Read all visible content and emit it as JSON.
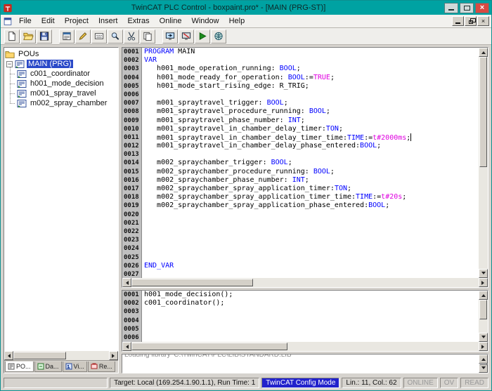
{
  "titlebar": {
    "title": "TwinCAT PLC Control - boxpaint.pro* - [MAIN (PRG-ST)]"
  },
  "menubar": {
    "items": [
      "File",
      "Edit",
      "Project",
      "Insert",
      "Extras",
      "Online",
      "Window",
      "Help"
    ]
  },
  "toolbar": {
    "buttons": [
      {
        "icon": "new-file-icon"
      },
      {
        "icon": "open-file-icon"
      },
      {
        "icon": "save-icon"
      },
      {
        "icon": "new-pou-icon",
        "group": true
      },
      {
        "icon": "edit-declaration-icon"
      },
      {
        "icon": "input-assistant-icon"
      },
      {
        "icon": "find-icon"
      },
      {
        "icon": "cut-icon"
      },
      {
        "icon": "copy-icon"
      },
      {
        "icon": "login-icon",
        "group": true
      },
      {
        "icon": "logout-icon"
      },
      {
        "icon": "run-icon"
      },
      {
        "icon": "global-variables-icon"
      }
    ]
  },
  "sidebar": {
    "root_label": "POUs",
    "selected_item": "MAIN (PRG)",
    "items": [
      "c001_coordinator",
      "h001_mode_decision",
      "m001_spray_travel",
      "m002_spray_chamber"
    ],
    "tabs": [
      {
        "label": "PO...",
        "icon": "pous-tab-icon",
        "active": true
      },
      {
        "label": "Da...",
        "icon": "data-types-tab-icon",
        "active": false
      },
      {
        "label": "Vi...",
        "icon": "visualizations-tab-icon",
        "active": false
      },
      {
        "label": "Re...",
        "icon": "resources-tab-icon",
        "active": false
      }
    ]
  },
  "declaration_editor": {
    "lines": [
      {
        "num": "0001",
        "segs": [
          [
            "PROGRAM",
            "k"
          ],
          [
            " MAIN",
            "p"
          ]
        ]
      },
      {
        "num": "0002",
        "segs": [
          [
            "VAR",
            "k"
          ]
        ]
      },
      {
        "num": "0003",
        "segs": [
          [
            "   h001_mode_operation_running: ",
            "p"
          ],
          [
            "BOOL",
            "k"
          ],
          [
            ";",
            "p"
          ]
        ]
      },
      {
        "num": "0004",
        "segs": [
          [
            "   h001_mode_ready_for_operation: ",
            "p"
          ],
          [
            "BOOL",
            "k"
          ],
          [
            ":=",
            "p"
          ],
          [
            "TRUE",
            "m"
          ],
          [
            ";",
            "p"
          ]
        ]
      },
      {
        "num": "0005",
        "segs": [
          [
            "   h001_mode_start_rising_edge: R_TRIG;",
            "p"
          ]
        ]
      },
      {
        "num": "0006",
        "segs": []
      },
      {
        "num": "0007",
        "segs": [
          [
            "   m001_spraytravel_trigger: ",
            "p"
          ],
          [
            "BOOL",
            "k"
          ],
          [
            ";",
            "p"
          ]
        ]
      },
      {
        "num": "0008",
        "segs": [
          [
            "   m001_spraytravel_procedure_running: ",
            "p"
          ],
          [
            "BOOL",
            "k"
          ],
          [
            ";",
            "p"
          ]
        ]
      },
      {
        "num": "0009",
        "segs": [
          [
            "   m001_spraytravel_phase_number: ",
            "p"
          ],
          [
            "INT",
            "k"
          ],
          [
            ";",
            "p"
          ]
        ]
      },
      {
        "num": "0010",
        "segs": [
          [
            "   m001_spraytravel_in_chamber_delay_timer:",
            "p"
          ],
          [
            "TON",
            "k"
          ],
          [
            ";",
            "p"
          ]
        ]
      },
      {
        "num": "0011",
        "caret": true,
        "segs": [
          [
            "   m001_spraytravel_in_chamber_delay_timer_time:",
            "p"
          ],
          [
            "TIME",
            "k"
          ],
          [
            ":=",
            "p"
          ],
          [
            "t#2000ms",
            "m"
          ],
          [
            ";",
            "p"
          ]
        ]
      },
      {
        "num": "0012",
        "segs": [
          [
            "   m001_spraytravel_in_chamber_delay_phase_entered:",
            "p"
          ],
          [
            "BOOL",
            "k"
          ],
          [
            ";",
            "p"
          ]
        ]
      },
      {
        "num": "0013",
        "segs": []
      },
      {
        "num": "0014",
        "segs": [
          [
            "   m002_spraychamber_trigger: ",
            "p"
          ],
          [
            "BOOL",
            "k"
          ],
          [
            ";",
            "p"
          ]
        ]
      },
      {
        "num": "0015",
        "segs": [
          [
            "   m002_spraychamber_procedure_running: ",
            "p"
          ],
          [
            "BOOL",
            "k"
          ],
          [
            ";",
            "p"
          ]
        ]
      },
      {
        "num": "0016",
        "segs": [
          [
            "   m002_spraychamber_phase_number: ",
            "p"
          ],
          [
            "INT",
            "k"
          ],
          [
            ";",
            "p"
          ]
        ]
      },
      {
        "num": "0017",
        "segs": [
          [
            "   m002_spraychamber_spray_application_timer:",
            "p"
          ],
          [
            "TON",
            "k"
          ],
          [
            ";",
            "p"
          ]
        ]
      },
      {
        "num": "0018",
        "segs": [
          [
            "   m002_spraychamber_spray_application_timer_time:",
            "p"
          ],
          [
            "TIME",
            "k"
          ],
          [
            ":=",
            "p"
          ],
          [
            "t#20s",
            "m"
          ],
          [
            ";",
            "p"
          ]
        ]
      },
      {
        "num": "0019",
        "segs": [
          [
            "   m002_spraychamber_spray_application_phase_entered:",
            "p"
          ],
          [
            "BOOL",
            "k"
          ],
          [
            ";",
            "p"
          ]
        ]
      },
      {
        "num": "0020",
        "segs": []
      },
      {
        "num": "0021",
        "segs": []
      },
      {
        "num": "0022",
        "segs": []
      },
      {
        "num": "0023",
        "segs": []
      },
      {
        "num": "0024",
        "segs": []
      },
      {
        "num": "0025",
        "segs": []
      },
      {
        "num": "0026",
        "segs": [
          [
            "END_VAR",
            "k"
          ]
        ]
      },
      {
        "num": "0027",
        "segs": []
      }
    ]
  },
  "implementation_editor": {
    "lines": [
      {
        "num": "0001",
        "segs": [
          [
            "h001_mode_decision();",
            "p"
          ]
        ]
      },
      {
        "num": "0002",
        "segs": [
          [
            "c001_coordinator();",
            "p"
          ]
        ]
      },
      {
        "num": "0003",
        "segs": []
      },
      {
        "num": "0004",
        "segs": []
      },
      {
        "num": "0005",
        "segs": []
      },
      {
        "num": "0006",
        "segs": []
      }
    ]
  },
  "message_pane": {
    "lines": [
      "Loading library 'C:\\TwinCAT\\PLC\\LIB\\STANDARD.LIB'"
    ]
  },
  "statusbar": {
    "target": "Target: Local (169.254.1.90.1.1), Run Time: 1",
    "mode": "TwinCAT Config Mode",
    "position": "Lin.: 11, Col.: 62",
    "online": "ONLINE",
    "ov": "OV",
    "read": "READ"
  },
  "colors": {
    "titlebar": "#00a2a2",
    "keyword": "#0000ff",
    "constant": "#e000e0",
    "selection": "#2a49c8",
    "config_mode_bg": "#2222cc",
    "close_button": "#d84a42"
  }
}
